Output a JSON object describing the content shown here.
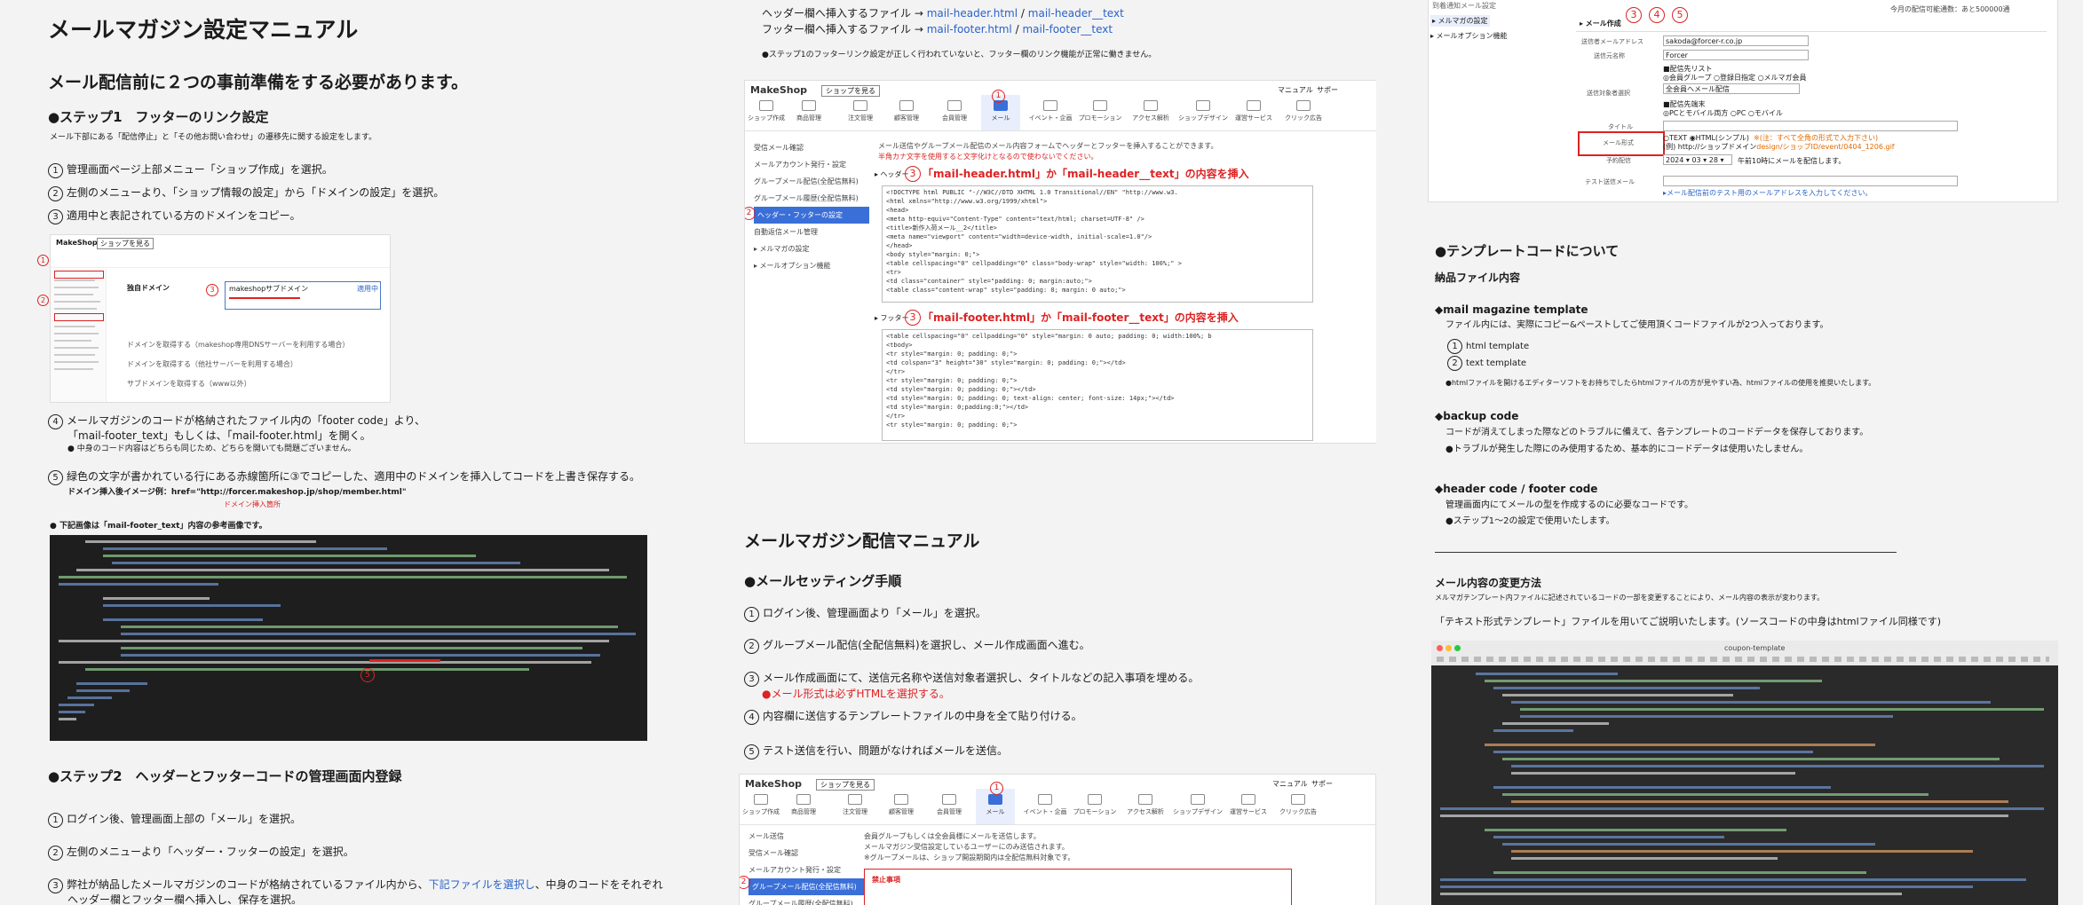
{
  "col1": {
    "title": "メールマガジン設定マニュアル",
    "intro": "メール配信前に２つの事前準備をする必要があります。",
    "step1": {
      "heading": "●ステップ1　フッターのリンク設定",
      "note": "メール下部にある「配信停止」と「その他お問い合わせ」の遷移先に関する設定をします。",
      "items": [
        {
          "n": "1",
          "text": "管理画面ページ上部メニュー「ショップ作成」を選択。"
        },
        {
          "n": "2",
          "text": "左側のメニューより、「ショップ情報の設定」から「ドメインの設定」を選択。"
        },
        {
          "n": "3",
          "text": "適用中と表記されている方のドメインをコピー。"
        }
      ],
      "item4_line1": "メールマガジンのコードが格納されたファイル内の「footer code」より、",
      "item4_line2": "「mail-footer_text」もしくは、「mail-footer.html」を開く。",
      "item4_note": "● 中身のコード内容はどちらも同じため、どちらを開いても問題ございません。",
      "item5": "緑色の文字が書かれている行にある赤線箇所に③でコピーした、適用中のドメインを挿入してコードを上書き保存する。",
      "item5_example": "ドメイン挿入後イメージ例：href=\"http://forcer.makeshop.jp/shop/member.html\"",
      "item5_marker": "ドメイン挿入箇所",
      "ref_note": "● 下記画像は「mail-footer_text」内容の参考画像です。"
    },
    "step2": {
      "heading": "●ステップ2　ヘッダーとフッターコードの管理画面内登録",
      "items": [
        {
          "n": "1",
          "text": "ログイン後、管理画面上部の「メール」を選択。"
        },
        {
          "n": "2",
          "text": "左側のメニューより「ヘッダー・フッターの設定」を選択。"
        }
      ],
      "item3_pre": "弊社が納品したメールマガジンのコードが格納されているファイル内から、",
      "item3_link": "下記ファイルを選択し",
      "item3_post": "、中身のコードをそれぞれ",
      "item3_line2": "ヘッダー欄とフッター欄へ挿入し、保存を選択。"
    },
    "mini_shot": {
      "brand": "MakeShop",
      "shop_btn": "ショップを見る",
      "domain_title": "独自ドメイン",
      "domain_label": "makeshopサブドメイン",
      "setting_btn": "適用中",
      "rows": [
        "ドメインを取得する（makeshop専用DNSサーバーを利用する場合）",
        "ドメインを取得する（他社サーバーを利用する場合）",
        "サブドメインを取得する（www以外）"
      ]
    }
  },
  "col2": {
    "header_line_label": "ヘッダー欄へ挿入するファイル →",
    "header_file1": "mail-header.html",
    "header_file2": "mail-header__text",
    "footer_line_label": "フッター欄へ挿入するファイル →",
    "footer_file1": "mail-footer.html",
    "footer_file2": "mail-footer__text",
    "slash": "/",
    "warning": "●ステップ1のフッターリンク設定が正しく行われていないと、フッター欄のリンク機能が正常に働きません。",
    "shot1": {
      "brand": "MakeShop",
      "shop_btn": "ショップを見る",
      "top_right": [
        "マニュアル",
        "サポー"
      ],
      "nav": [
        "ショップ作成",
        "商品管理",
        "注文管理",
        "顧客管理",
        "会員管理",
        "メール",
        "イベント・企画",
        "プロモーション",
        "アクセス解析",
        "ショップデザイン",
        "運営サービス",
        "クリック広告"
      ],
      "sidebar": [
        "受信メール確認",
        "メールアカウント発行・設定",
        "グループメール配信(全配信無料)",
        "グループメール履歴(全配信無料)",
        "ヘッダー・フッターの設定",
        "自動返信メール管理",
        "▸ メルマガの設定",
        "▸ メールオプション機能"
      ],
      "desc1": "メール送信やグループメール配信のメール内容フォームでヘッダーとフッターを挿入することができます。",
      "desc2": "半角カナ文字を使用すると文字化けとなるので使わないでください。",
      "header_label": "▸ ヘッダー",
      "header_instruction": "「mail-header.html」か「mail-header__text」の内容を挿入",
      "footer_label": "▸ フッター",
      "footer_instruction": "「mail-footer.html」か「mail-footer__text」の内容を挿入",
      "header_code": [
        "<!DOCTYPE html PUBLIC \"-//W3C//DTD XHTML 1.0 Transitional//EN\" \"http://www.w3.",
        "<html xmlns=\"http://www.w3.org/1999/xhtml\">",
        "<head>",
        "<meta http-equiv=\"Content-Type\" content=\"text/html; charset=UTF-8\" />",
        "<title>新作入荷メール__2</title>",
        "<meta name=\"viewport\" content=\"width=device-width, initial-scale=1.0\"/>",
        "</head>",
        "<body style=\"margin: 0;\">",
        "  <table cellspacing=\"0\" cellpadding=\"0\" class=\"body-wrap\" style=\"width: 100%;\" >",
        "    <tr>",
        "      <td class=\"container\" style=\"padding: 0; margin:auto;\">",
        "        <table class=\"content-wrap\" style=\"padding: 0; margin: 0 auto;\">"
      ],
      "footer_code": [
        "<table cellspacing=\"0\" cellpadding=\"0\" style=\"margin: 0 auto; padding: 0; width:100%; b",
        "  <tbody>",
        "    <tr style=\"margin: 0; padding: 0;\">",
        "      <td colspan=\"3\" height=\"30\" style=\"margin: 0; padding: 0;\"></td>",
        "    </tr>",
        "    <tr style=\"margin: 0; padding: 0;\">",
        "      <td style=\"margin: 0; padding: 0;\"></td>",
        "      <td style=\"margin: 0; padding: 0; text-align: center; font-size: 14px;\"></td>",
        "      <td style=\"margin: 0;padding:0;\"></td>",
        "    </tr>",
        "    <tr style=\"margin: 0; padding: 0;\">"
      ]
    },
    "delivery": {
      "title": "メールマガジン配信マニュアル",
      "heading": "●メールセッティング手順",
      "items": [
        {
          "n": "1",
          "text": "ログイン後、管理画面より「メール」を選択。"
        },
        {
          "n": "2",
          "text": "グループメール配信(全配信無料)を選択し、メール作成画面へ進む。"
        },
        {
          "n": "3",
          "text": "メール作成画面にて、送信元名称や送信対象者選択し、タイトルなどの記入事項を埋める。"
        },
        {
          "n": "4",
          "text": "内容欄に送信するテンプレートファイルの中身を全て貼り付ける。"
        },
        {
          "n": "5",
          "text": "テスト送信を行い、問題がなければメールを送信。"
        }
      ],
      "html_note": "●メール形式は必ずHTMLを選択する。"
    },
    "shot2": {
      "sidebar": [
        "メール送信",
        "受信メール確認",
        "メールアカウント発行・設定",
        "グループメール配信(全配信無料)",
        "グループメール履歴(全配信無料)"
      ],
      "desc1": "会員グループもしくは全会員様にメールを送信します。",
      "desc2": "メールマガジン受信設定しているユーザーにのみ送信されます。",
      "desc3": "※グループメールは、ショップ開設期間内は全配信無料対象です。",
      "warn_title": "禁止事項"
    }
  },
  "col3": {
    "shot3": {
      "side_top": "到着通知メール設定",
      "side": [
        "▸ メルマガの設定",
        "▸ メールオプション機能"
      ],
      "top_right": "今月の配信可能通数：あと500000通",
      "form_title": "▸ メール作成",
      "rows": [
        "送信者メールアドレス",
        "送信元名称",
        "送信対象者選択",
        "タイトル",
        "メール形式",
        "予約配信",
        "テスト送信メール"
      ],
      "sender": "sakoda@forcer-r.co.jp",
      "sender_name": "Forcer",
      "target_opt1": "■配信先リスト",
      "target_opt2": "◎会員グループ ○登録日指定 ○メルマガ会員",
      "target_select": "全会員へメール配信",
      "target_opt3": "■配信先端末",
      "target_opt4": "◎PCとモバイル両方 ○PC ○モバイル",
      "format_opts": "○TEXT ◉HTML(シンプル)",
      "format_note": "※(注：すべて全角の形式で入力下さい)",
      "format_example": "(例) http://ショップドメイン",
      "format_path": "design/ショップID/event/0404_1206.gif",
      "date": "2024 ▾ 03 ▾ 28 ▾",
      "time_note": "午前10時にメールを配信します。",
      "test_note": "▸メール配信前のテスト用のメールアドレスを入力してください。"
    },
    "template": {
      "heading": "●テンプレートコードについて",
      "sub": "納品ファイル内容",
      "mm_title": "◆mail magazine template",
      "mm_desc": "ファイル内には、実際にコピー&ペーストしてご使用頂くコードファイルが2つ入っております。",
      "mm_items": [
        {
          "n": "1",
          "text": "html template"
        },
        {
          "n": "2",
          "text": "text template"
        }
      ],
      "mm_note": "●htmlファイルを開けるエディターソフトをお持ちでしたらhtmlファイルの方が見やすい為、htmlファイルの使用を推奨いたします。",
      "backup_title": "◆backup code",
      "backup_desc": "コードが消えてしまった際などのトラブルに備えて、各テンプレートのコードデータを保存しております。",
      "backup_note": "●トラブルが発生した際にのみ使用するため、基本的にコードデータは使用いたしません。",
      "hf_title": "◆header code / footer code",
      "hf_desc": "管理画面内にてメールの型を作成するのに必要なコードです。",
      "hf_note": "●ステップ1〜2の設定で使用いたします。"
    },
    "change": {
      "heading": "メール内容の変更方法",
      "desc": "メルマガテンプレート内ファイルに記述されているコードの一部を変更することにより、メール内容の表示が変わります。",
      "text_template_note": "「テキスト形式テンプレート」ファイルを用いてご説明いたします。(ソースコードの中身はhtmlファイル同様です)",
      "editor_title": "coupon-template"
    }
  },
  "colors": {
    "accent_red": "#d22222",
    "link_blue": "#2a62c9",
    "nav_active": "#3a6fd8",
    "code_bg": "#1e1e1e"
  }
}
